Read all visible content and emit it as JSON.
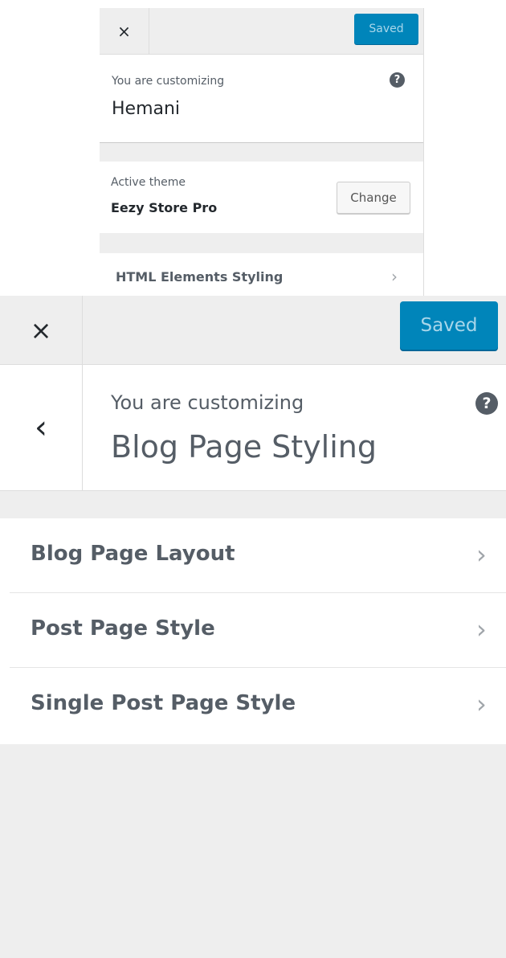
{
  "small_panel": {
    "close_icon": "×",
    "save_label": "Saved",
    "customizing_label": "You are customizing",
    "customizing_title": "Hemani",
    "help_icon": "?",
    "active_theme_label": "Active theme",
    "active_theme_name": "Eezy Store Pro",
    "change_label": "Change",
    "section": {
      "label": "HTML Elements Styling",
      "chevron": "›"
    }
  },
  "main_panel": {
    "close_icon": "×",
    "save_label": "Saved",
    "back_icon": "‹",
    "customizing_label": "You are customizing",
    "customizing_title": "Blog Page Styling",
    "help_icon": "?",
    "sections": [
      {
        "label": "Blog Page Layout",
        "chevron": "›"
      },
      {
        "label": "Post Page Style",
        "chevron": "›"
      },
      {
        "label": "Single Post Page Style",
        "chevron": "›"
      }
    ]
  },
  "colors": {
    "accent": "#0085ba",
    "panel_bg": "#eeeeee",
    "text": "#555d66"
  }
}
